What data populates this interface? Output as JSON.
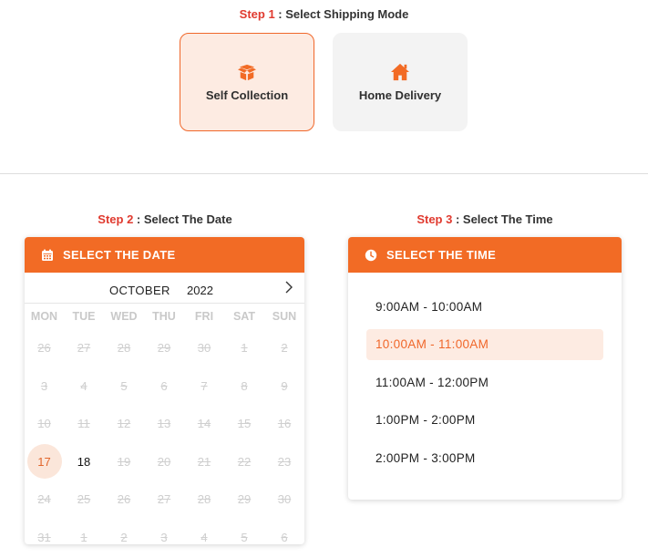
{
  "step1": {
    "num": "Step 1",
    "sep": " : ",
    "text": "Select Shipping Mode"
  },
  "shipping_modes": [
    {
      "label": "Self Collection",
      "icon": "box-icon",
      "selected": true
    },
    {
      "label": "Home Delivery",
      "icon": "home-icon",
      "selected": false
    }
  ],
  "step2": {
    "num": "Step 2",
    "sep": " : ",
    "text": "Select The Date"
  },
  "step3": {
    "num": "Step 3",
    "sep": " : ",
    "text": "Select The Time"
  },
  "date_panel": {
    "header": "SELECT THE DATE",
    "header_icon": "calendar-icon",
    "month": "OCTOBER",
    "year": "2022",
    "next_icon": "chevron-right-icon",
    "weekdays": [
      "MON",
      "TUE",
      "WED",
      "THU",
      "FRI",
      "SAT",
      "SUN"
    ],
    "weeks": [
      [
        "26",
        "27",
        "28",
        "29",
        "30",
        "1",
        "2"
      ],
      [
        "3",
        "4",
        "5",
        "6",
        "7",
        "8",
        "9"
      ],
      [
        "10",
        "11",
        "12",
        "13",
        "14",
        "15",
        "16"
      ],
      [
        "17",
        "18",
        "19",
        "20",
        "21",
        "22",
        "23"
      ],
      [
        "24",
        "25",
        "26",
        "27",
        "28",
        "29",
        "30"
      ],
      [
        "31",
        "1",
        "2",
        "3",
        "4",
        "5",
        "6"
      ]
    ],
    "selected_day": "17",
    "available_days": [
      "17",
      "18"
    ]
  },
  "time_panel": {
    "header": "SELECT THE TIME",
    "header_icon": "clock-icon",
    "slots": [
      "9:00AM - 10:00AM",
      "10:00AM - 11:00AM",
      "11:00AM - 12:00PM",
      "1:00PM - 2:00PM",
      "2:00PM - 3:00PM"
    ],
    "selected_slot": "10:00AM - 11:00AM"
  },
  "colors": {
    "accent": "#f26b25",
    "step_number": "#e03a2f",
    "selected_bg": "#fdebe2"
  }
}
